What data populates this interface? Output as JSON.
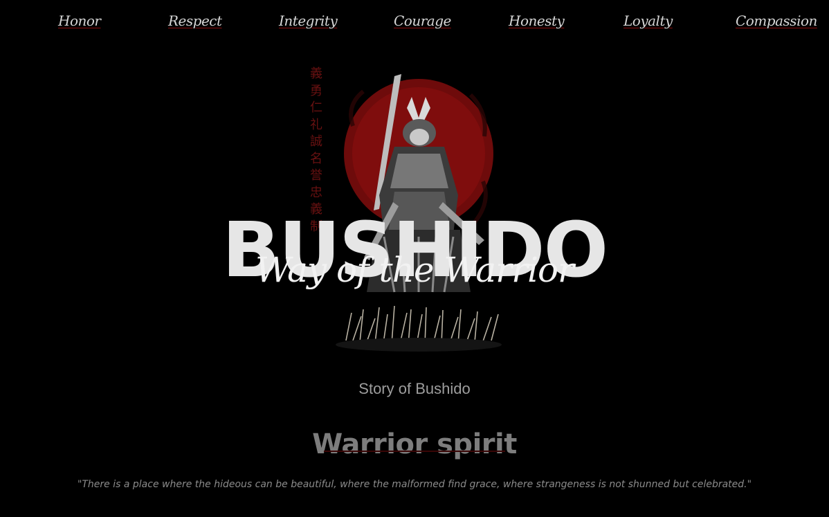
{
  "nav": {
    "items": [
      {
        "label": "Honor"
      },
      {
        "label": "Respect"
      },
      {
        "label": "Integrity"
      },
      {
        "label": "Courage"
      },
      {
        "label": "Honesty"
      },
      {
        "label": "Loyalty"
      },
      {
        "label": "Compassion"
      }
    ]
  },
  "hero": {
    "kanji": "義勇仁礼誠名誉忠義制",
    "title": "BUSHIDO",
    "subtitle": "Way of the Warrior"
  },
  "story": {
    "kicker": "Story of Bushido",
    "heading": "Warrior spirit",
    "quote": "\"There is a place where the hideous can be beautiful, where the malformed find grace, where strangeness is not shunned but celebrated.\""
  },
  "colors": {
    "background": "#000000",
    "accent_red": "#8b0b0b",
    "sun_red": "#7f0d0d"
  }
}
